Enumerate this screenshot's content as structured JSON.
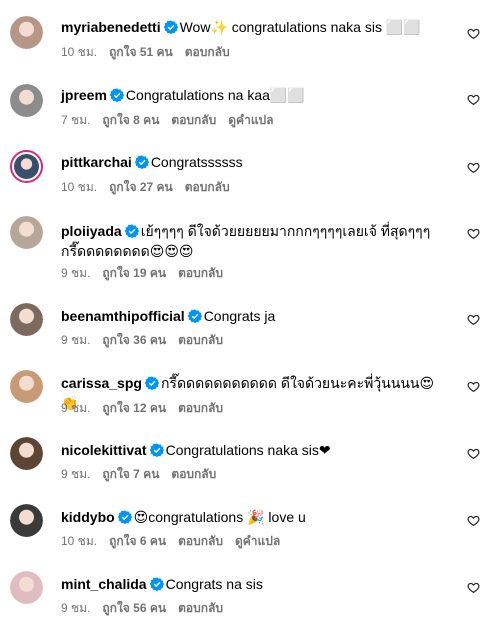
{
  "comments": [
    {
      "user": "myriabenedetti",
      "text": "Wow✨ congratulations naka sis ⬜⬜",
      "time": "10 ชม.",
      "likes": "ถูกใจ 51 คน",
      "reply": "ตอบกลับ",
      "translate": "",
      "avatar": "#b69687"
    },
    {
      "user": "jpreem",
      "text": "Congratulations na kaa⬜⬜",
      "time": "7 ชม.",
      "likes": "ถูกใจ 8 คน",
      "reply": "ตอบกลับ",
      "translate": "ดูคำแปล",
      "avatar": "#8c8c8c"
    },
    {
      "user": "pittkarchai",
      "text": "Congratssssss",
      "time": "10 ชม.",
      "likes": "ถูกใจ 27 คน",
      "reply": "ตอบกลับ",
      "translate": "",
      "avatar": "#3a4f6e"
    },
    {
      "user": "ploiiyada",
      "text": "เย้ๆๆๆๆ ดีใจด้วยยยยยมากกกๆๆๆๆเลยเจ้ ที่สุดๆๆๆ กรี๊ดดดดดดดด😍😍😍",
      "time": "9 ชม.",
      "likes": "ถูกใจ 19 คน",
      "reply": "ตอบกลับ",
      "translate": "",
      "avatar": "#b7a79a"
    },
    {
      "user": "beenamthipofficial",
      "text": "Congrats ja",
      "time": "9 ชม.",
      "likes": "ถูกใจ 36 คน",
      "reply": "ตอบกลับ",
      "translate": "",
      "avatar": "#7d6a5f"
    },
    {
      "user": "carissa_spg",
      "text": "กรี๊ดดดดดดดดดดด ดีใจด้วยนะคะพี่วุ้นนนน😍 👏",
      "time": "9 ชม.",
      "likes": "ถูกใจ 12 คน",
      "reply": "ตอบกลับ",
      "translate": "",
      "avatar": "#c99a76"
    },
    {
      "user": "nicolekittivat",
      "text": "Congratulations naka sis❤",
      "time": "9 ชม.",
      "likes": "ถูกใจ 7 คน",
      "reply": "ตอบกลับ",
      "translate": "",
      "avatar": "#5e4533"
    },
    {
      "user": "kiddybo",
      "text": "😍congratulations 🎉 love u",
      "time": "10 ชม.",
      "likes": "ถูกใจ 6 คน",
      "reply": "ตอบกลับ",
      "translate": "ดูคำแปล",
      "avatar": "#3a3a3a"
    },
    {
      "user": "mint_chalida",
      "text": "Congrats na sis",
      "time": "9 ชม.",
      "likes": "ถูกใจ 56 คน",
      "reply": "ตอบกลับ",
      "translate": "",
      "avatar": "#e0bcc0"
    }
  ],
  "colors": {
    "verified": "#0095f6",
    "meta": "#737373",
    "ring": "#d62976"
  }
}
